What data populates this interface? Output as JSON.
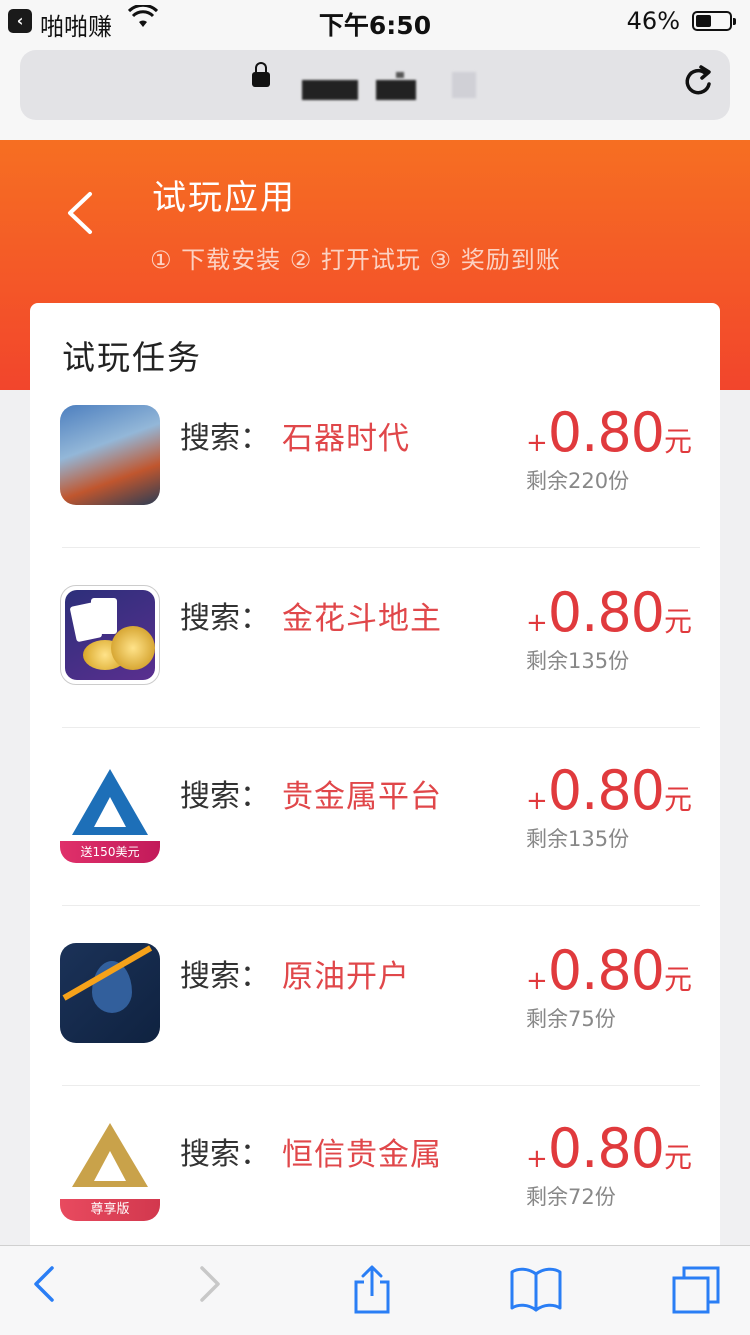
{
  "status_bar": {
    "back_app": "啪啪赚",
    "time": "下午6:50",
    "battery_percent": "46%",
    "battery_level": 0.46
  },
  "header": {
    "title": "试玩应用",
    "steps": "① 下载安装 ② 打开试玩 ③ 奖励到账",
    "back_icon": "chevron-left-icon"
  },
  "card": {
    "title": "试玩任务",
    "tasks": [
      {
        "label": "搜索：",
        "keyword": "石器时代",
        "plus": "+",
        "amount": "0.80",
        "unit": "元",
        "remaining": "剩余220份"
      },
      {
        "label": "搜索：",
        "keyword": "金花斗地主",
        "plus": "+",
        "amount": "0.80",
        "unit": "元",
        "remaining": "剩余135份"
      },
      {
        "label": "搜索：",
        "keyword": "贵金属平台",
        "plus": "+",
        "amount": "0.80",
        "unit": "元",
        "remaining": "剩余135份",
        "badge": "送150美元"
      },
      {
        "label": "搜索：",
        "keyword": "原油开户",
        "plus": "+",
        "amount": "0.80",
        "unit": "元",
        "remaining": "剩余75份"
      },
      {
        "label": "搜索：",
        "keyword": "恒信贵金属",
        "plus": "+",
        "amount": "0.80",
        "unit": "元",
        "remaining": "剩余72份",
        "badge": "尊享版"
      }
    ]
  },
  "colors": {
    "header_top": "#f66f22",
    "header_bottom": "#f2452c",
    "keyword": "#e0474a",
    "price": "#e03a3d",
    "toolbar_accent": "#2a7ef5"
  },
  "toolbar": {
    "back_icon": "chevron-left-icon",
    "forward_icon": "chevron-right-icon",
    "share_icon": "share-icon",
    "bookmarks_icon": "book-icon",
    "tabs_icon": "tabs-icon"
  }
}
